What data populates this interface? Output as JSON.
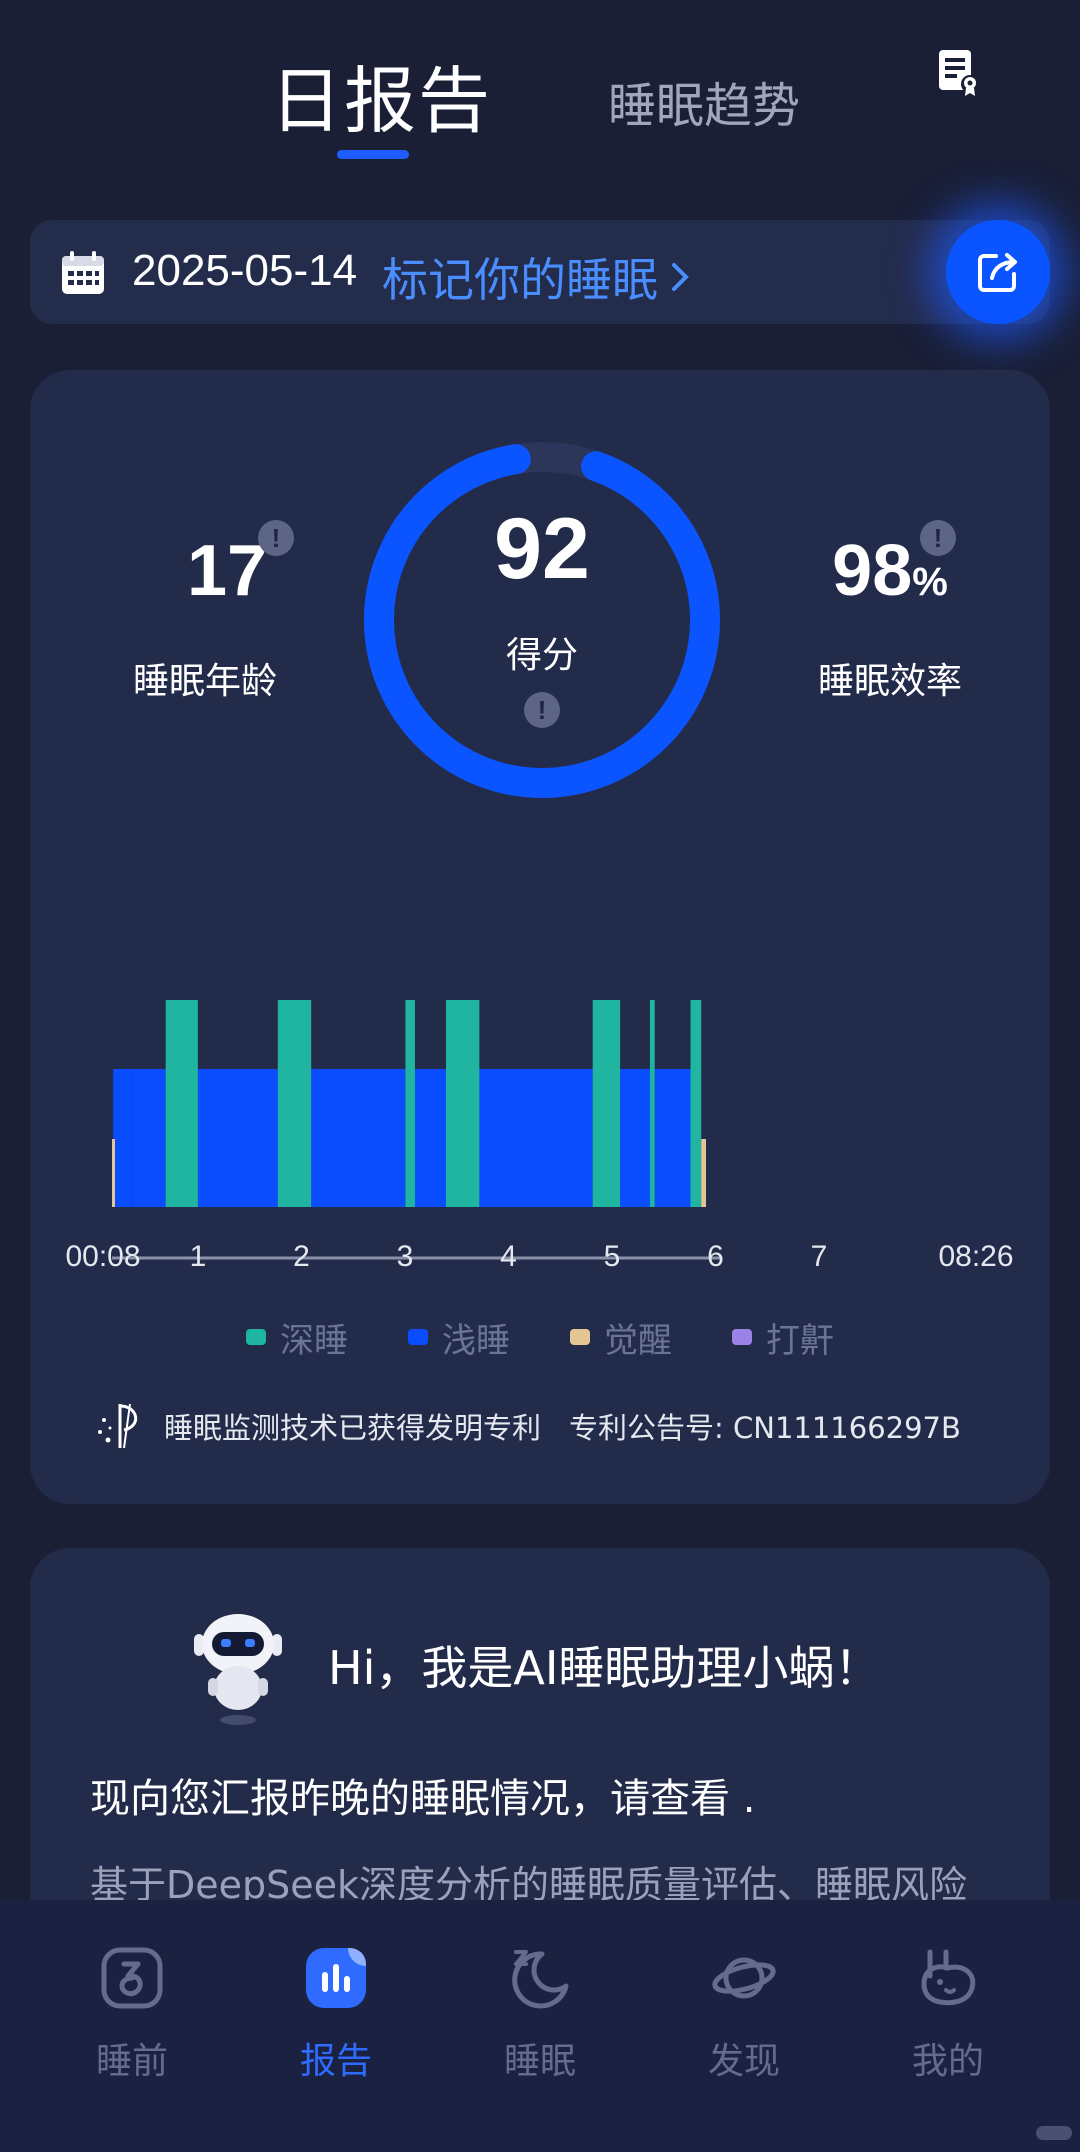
{
  "tabs": {
    "daily": "日报告",
    "trend": "睡眠趋势",
    "report_icon": "report-document-icon"
  },
  "date_bar": {
    "date": "2025-05-14",
    "mark_label": "标记你的睡眠",
    "calendar_icon": "calendar-icon",
    "share_icon": "share-export-icon"
  },
  "summary": {
    "sleep_age_value": "17",
    "sleep_age_label": "睡眠年龄",
    "score_value": "92",
    "score_label": "得分",
    "score_progress": 0.92,
    "efficiency_value": "98",
    "efficiency_unit": "%",
    "efficiency_label": "睡眠效率",
    "info_badge": "!"
  },
  "chart_data": {
    "type": "bar",
    "x_axis_labels": [
      "00:08",
      "1",
      "2",
      "3",
      "4",
      "5",
      "6",
      "7",
      "08:26"
    ],
    "start_time": "00:08",
    "end_time": "08:26",
    "stage_levels": {
      "deep": 3,
      "light": 2,
      "awake": 1
    },
    "segments": [
      {
        "stage": "awake",
        "start": "00:08",
        "end": "00:09"
      },
      {
        "stage": "light",
        "start": "00:09",
        "end": "00:25"
      },
      {
        "stage": "deep",
        "start": "00:53",
        "end": "01:20"
      },
      {
        "stage": "light",
        "start": "00:25",
        "end": "00:53"
      },
      {
        "stage": "light",
        "start": "01:20",
        "end": "02:27"
      },
      {
        "stage": "deep",
        "start": "02:27",
        "end": "02:55"
      },
      {
        "stage": "light",
        "start": "02:55",
        "end": "04:14"
      },
      {
        "stage": "deep",
        "start": "04:14",
        "end": "04:22"
      },
      {
        "stage": "light",
        "start": "04:22",
        "end": "04:48"
      },
      {
        "stage": "deep",
        "start": "04:48",
        "end": "05:16"
      },
      {
        "stage": "light",
        "start": "05:16",
        "end": "06:51"
      },
      {
        "stage": "deep",
        "start": "06:51",
        "end": "07:14"
      },
      {
        "stage": "light",
        "start": "07:14",
        "end": "07:39"
      },
      {
        "stage": "deep",
        "start": "07:39",
        "end": "07:43"
      },
      {
        "stage": "light",
        "start": "07:43",
        "end": "08:13"
      },
      {
        "stage": "deep",
        "start": "08:13",
        "end": "08:22"
      },
      {
        "stage": "awake",
        "start": "08:22",
        "end": "08:26"
      }
    ],
    "legend": [
      {
        "key": "deep",
        "name": "深睡",
        "color": "#1fb5a0"
      },
      {
        "key": "light",
        "name": "浅睡",
        "color": "#0a4dff"
      },
      {
        "key": "awake",
        "name": "觉醒",
        "color": "#e6c594"
      },
      {
        "key": "snore",
        "name": "打鼾",
        "color": "#9b82e8"
      }
    ]
  },
  "patent": {
    "text": "睡眠监测技术已获得发明专利",
    "number": "专利公告号: CN111166297B"
  },
  "ai_card": {
    "greeting": "Hi，我是AI睡眠助理小蜗！",
    "line1": "现向您汇报昨晚的睡眠情况，请查看 .",
    "line2": "基于DeepSeek深度分析的睡眠质量评估、睡眠风险"
  },
  "nav": {
    "items": [
      {
        "label": "睡前",
        "icon": "presleep-icon"
      },
      {
        "label": "报告",
        "icon": "report-chart-icon"
      },
      {
        "label": "睡眠",
        "icon": "moon-sleep-icon"
      },
      {
        "label": "发现",
        "icon": "planet-discover-icon"
      },
      {
        "label": "我的",
        "icon": "profile-icon"
      }
    ]
  },
  "colors": {
    "background": "#1a1f36",
    "card": "#232b4a",
    "accent": "#0a55ff",
    "link": "#4a8dff",
    "deep": "#1fb5a0",
    "light": "#0a4dff",
    "awake": "#e6c594",
    "snore": "#9b82e8"
  }
}
